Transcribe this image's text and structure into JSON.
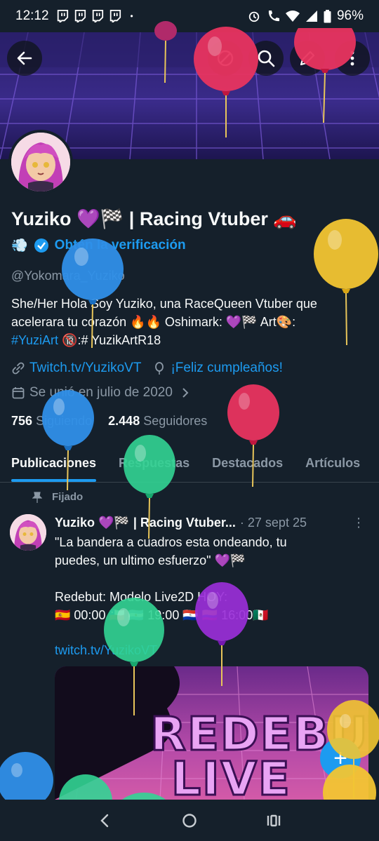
{
  "status_bar": {
    "time": "12:12",
    "battery": "96%",
    "dot": "•"
  },
  "header": {
    "back_icon": "arrow-left-icon",
    "search_icon": "search-icon",
    "edit_icon": "pencil-icon",
    "more_icon": "more-vertical-icon"
  },
  "profile": {
    "name": "Yuziko 💜🏁 | Racing Vtuber 🚗",
    "name_extra": "💨",
    "verify_link": "Obtén la verificación",
    "handle": "@Yokomara_Yuziko",
    "bio_line1": "She/Her Hola Soy Yuziko, una RaceQueen Vtuber que",
    "bio_line2": "acelerara tu corazón 🔥🔥  Oshimark: 💜🏁 Art🎨:",
    "bio_hashtag": "#YuziArt",
    "bio_line3_rest": " 🔞:# YuzikArtR18",
    "website": "Twitch.tv/YuzikoVT",
    "birthday": "¡Feliz cumpleaños!",
    "joined": "Se unió en julio de 2020",
    "following_count": "756",
    "following_label": "Siguiendo",
    "followers_count": "2.448",
    "followers_label": "Seguidores"
  },
  "tabs": [
    {
      "label": "Publicaciones",
      "active": true
    },
    {
      "label": "Respuestas"
    },
    {
      "label": "Destacados"
    },
    {
      "label": "Artículos"
    }
  ],
  "pinned_post": {
    "pinned_label": "Fijado",
    "author": "Yuziko 💜🏁 | Racing Vtuber...",
    "date": "· 27 sept 25",
    "more": "⋮",
    "lines": [
      "\"La bandera a cuadros esta ondeando, tu",
      "puedes, un ultimo esfuerzo\" 💜🏁",
      "",
      "Redebut: Modelo Live2D HOY:",
      "🇪🇸 00:00 🇨🇱 🇦🇷 19:00 🇵🇾 🇨🇴 16:00🇲🇽"
    ],
    "link": "twitch.tv/YuzikoVT",
    "media_line1": "REDEBUT",
    "media_line2": "LIVE 2D"
  },
  "fab": {
    "label": "+"
  },
  "colors": {
    "background": "#15202b",
    "accent": "#1d9bf0",
    "muted": "#8b98a5",
    "text": "#f7f9f9"
  }
}
